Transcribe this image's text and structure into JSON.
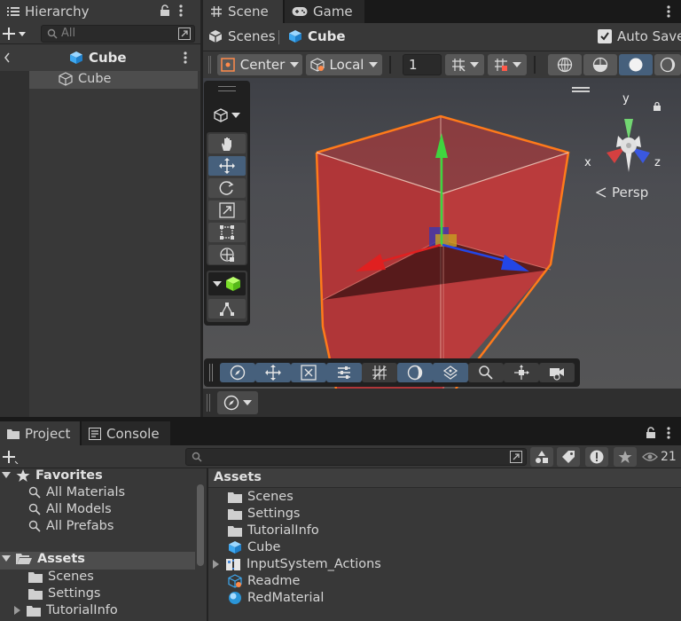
{
  "hierarchy": {
    "tab_label": "Hierarchy",
    "search_placeholder": "All",
    "scene_object": "Cube",
    "child_object": "Cube"
  },
  "scene_tabs": {
    "scene_label": "Scene",
    "game_label": "Game"
  },
  "breadcrumb": {
    "scenes": "Scenes",
    "current": "Cube",
    "auto_save": "Auto Save",
    "auto_save_checked": true
  },
  "scene_toolbar": {
    "pivot": "Center",
    "space": "Local",
    "grid_size": "1"
  },
  "gizmo": {
    "y_label": "y",
    "x_label": "x",
    "z_label": "z",
    "projection": "Persp"
  },
  "project": {
    "project_tab": "Project",
    "console_tab": "Console",
    "hidden_count": "21",
    "favorites_label": "Favorites",
    "favorites": [
      "All Materials",
      "All Models",
      "All Prefabs"
    ],
    "assets_label": "Assets",
    "asset_folders": [
      "Scenes",
      "Settings",
      "TutorialInfo"
    ],
    "assets_header": "Assets",
    "assets_items": [
      "Scenes",
      "Settings",
      "TutorialInfo",
      "Cube",
      "InputSystem_Actions",
      "Readme",
      "RedMaterial"
    ]
  },
  "colors": {
    "panel_bg": "#383838",
    "dark_bg": "#191919",
    "selection": "#46607c",
    "cube_red": "#c8383a",
    "outline_orange": "#ff7a1a",
    "axis_green": "#3fd43f",
    "axis_red": "#e02020",
    "axis_blue": "#2346e6"
  }
}
